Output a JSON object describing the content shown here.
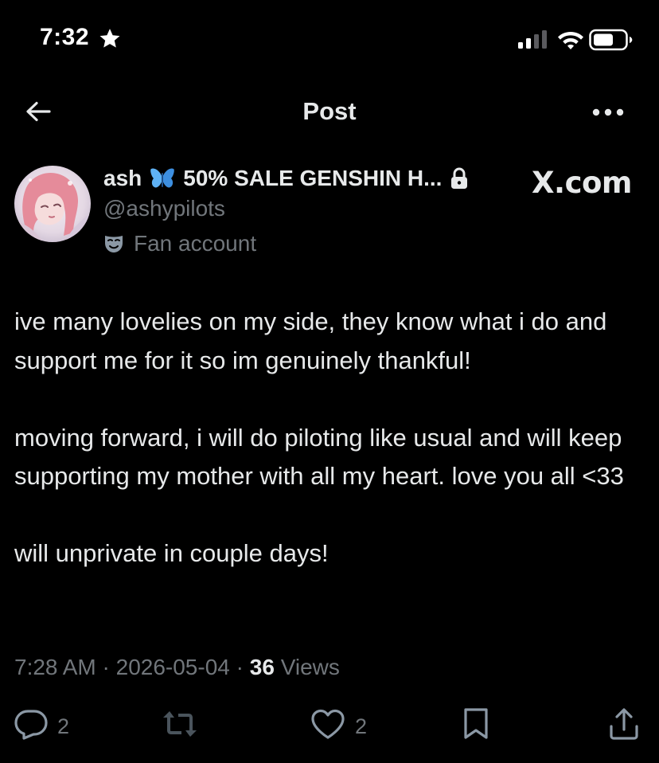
{
  "status_bar": {
    "time": "7:32",
    "star_icon": "star-icon",
    "signal_icon": "cellular-signal-icon",
    "wifi_icon": "wifi-icon",
    "battery_icon": "battery-icon"
  },
  "header": {
    "back_icon": "back-arrow-icon",
    "title": "Post",
    "more_icon": "more-icon"
  },
  "user": {
    "display_name": "ash",
    "emoji_icon": "butterfly-icon",
    "name_suffix": "50% SALE GENSHIN H...",
    "lock_icon": "lock-icon",
    "handle": "@ashypilots",
    "label_icon": "mask-icon",
    "label": "Fan account"
  },
  "watermark": "X.com",
  "tweet": {
    "paragraphs": [
      "ive many lovelies on my side, they know what i do and support me for it so im genuinely thankful!",
      "moving forward, i will do piloting like usual and will keep supporting my mother with all my heart. love you all <33",
      "will unprivate in couple days!"
    ]
  },
  "meta": {
    "time": "7:28 AM",
    "separator": "·",
    "date": "2026-05-04",
    "views_count": "36",
    "views_label": "Views"
  },
  "actions": {
    "reply_count": "2",
    "like_count": "2"
  },
  "colors": {
    "background": "#000000",
    "text": "#e7e9ea",
    "secondary": "#71767b",
    "butterfly": "#5fb2f5"
  }
}
